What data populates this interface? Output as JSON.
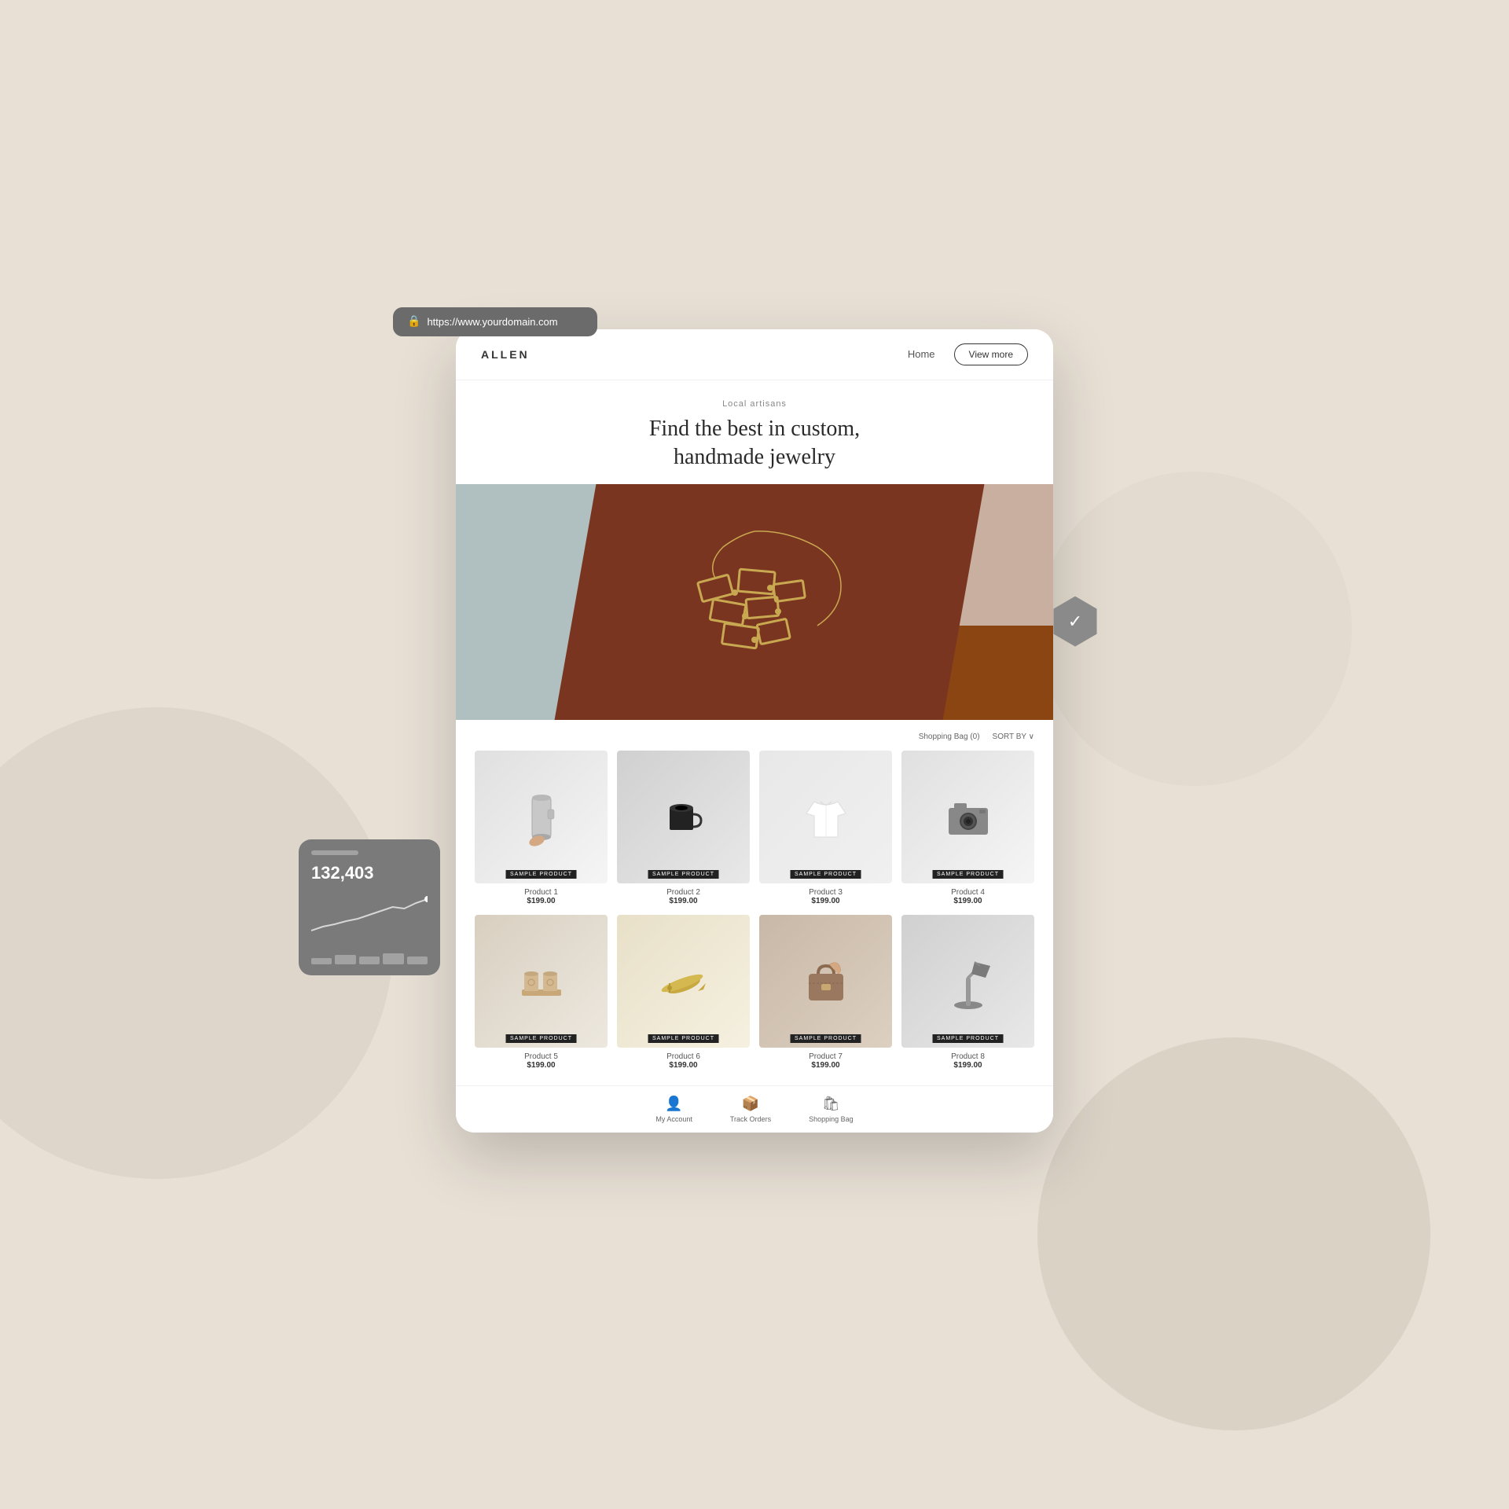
{
  "background": {
    "color": "#e8e0d5"
  },
  "urlbar": {
    "url": "https://www.yourdomain.com",
    "icon": "🔒"
  },
  "navbar": {
    "logo": "ALLEN",
    "links": [
      {
        "label": "Home"
      },
      {
        "label": "View more"
      }
    ],
    "view_more_btn": "View more"
  },
  "hero": {
    "subtitle": "Local artisans",
    "title": "Find the best in custom,\nhandmade jewelry"
  },
  "product_section": {
    "bag_label": "Shopping Bag (0)",
    "sort_label": "SORT BY ∨",
    "products": [
      {
        "id": 1,
        "name": "Product 1",
        "price": "$199.00",
        "badge": "SAMPLE PRODUCT",
        "type": "tumbler"
      },
      {
        "id": 2,
        "name": "Product 2",
        "price": "$199.00",
        "badge": "SAMPLE PRODUCT",
        "type": "mug"
      },
      {
        "id": 3,
        "name": "Product 3",
        "price": "$199.00",
        "badge": "SAMPLE PRODUCT",
        "type": "shirt"
      },
      {
        "id": 4,
        "name": "Product 4",
        "price": "$199.00",
        "badge": "SAMPLE PRODUCT",
        "type": "camera"
      },
      {
        "id": 5,
        "name": "Product 5",
        "price": "$199.00",
        "badge": "SAMPLE PRODUCT",
        "type": "cups"
      },
      {
        "id": 6,
        "name": "Product 6",
        "price": "$199.00",
        "badge": "SAMPLE PRODUCT",
        "type": "plane"
      },
      {
        "id": 7,
        "name": "Product 7",
        "price": "$199.00",
        "badge": "SAMPLE PRODUCT",
        "type": "bag"
      },
      {
        "id": 8,
        "name": "Product 8",
        "price": "$199.00",
        "badge": "SAMPLE PRODUCT",
        "type": "lamp"
      }
    ]
  },
  "bottom_nav": [
    {
      "label": "My Account",
      "icon": "👤"
    },
    {
      "label": "Track Orders",
      "icon": "📦"
    },
    {
      "label": "Shopping Bag",
      "icon": "🛍"
    }
  ],
  "stats_widget": {
    "number": "132,403",
    "bars": [
      2,
      3,
      5,
      4,
      7,
      6,
      8,
      9,
      7,
      10
    ]
  }
}
